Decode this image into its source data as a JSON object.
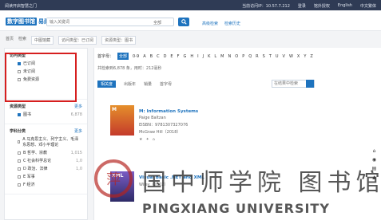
{
  "topbar": {
    "left": "阅读开启智慧之门",
    "right": [
      "当前访问IP：10.57.7.212",
      "登录",
      "馆外授权",
      "English",
      "中文繁体"
    ]
  },
  "logo": {
    "brand": "数字图书馆",
    "sub": "易阅通"
  },
  "search": {
    "placeholder": "输入关键词",
    "scope": "全部",
    "advanced": "高级检索",
    "history": "检索历史"
  },
  "breadcrumb": [
    "首页",
    "检索",
    "中图馆藏",
    "访问类型：已订阅",
    "资源类型：图书"
  ],
  "sidebar": {
    "access": {
      "title": "访问类型",
      "items": [
        {
          "label": "已订阅",
          "checked": true
        },
        {
          "label": "未订阅",
          "checked": false
        },
        {
          "label": "免费资源",
          "checked": false
        }
      ]
    },
    "resource": {
      "title": "资源类型",
      "more": "更多",
      "items": [
        {
          "label": "图书",
          "count": "6,878"
        }
      ]
    },
    "subject": {
      "title": "学科分类",
      "more": "更多",
      "items": [
        {
          "label": "A 马克思主义、列宁主义、毛泽东思想、邓小平理论",
          "count": ""
        },
        {
          "label": "B 哲学、宗教",
          "count": "1,015"
        },
        {
          "label": "C 社会科学总论",
          "count": "1,0"
        },
        {
          "label": "D 政治、法律",
          "count": "1,0"
        },
        {
          "label": "E 军事",
          "count": ""
        },
        {
          "label": "F 经济",
          "count": ""
        }
      ]
    }
  },
  "main": {
    "alpha_label": "首字母：",
    "alpha_active": "全部",
    "letters": [
      "0-9",
      "A",
      "B",
      "C",
      "D",
      "E",
      "F",
      "G",
      "H",
      "I",
      "J",
      "K",
      "L",
      "M",
      "N",
      "O",
      "P",
      "Q",
      "R",
      "S",
      "T",
      "U",
      "V",
      "W",
      "X",
      "Y",
      "Z"
    ],
    "found": "共检索到6,878 条，用时：212毫秒",
    "sort_active": "相关度",
    "sort_items": [
      "出版年",
      "销量",
      "首字母"
    ],
    "results_search_placeholder": "在结果中检索",
    "results": [
      {
        "title": "M: Information Systems",
        "author": "Paige Baltzan",
        "isbn": "EISBN：9781307327076",
        "publisher": "McGraw Hill（2018）",
        "cover_tag": "M"
      },
      {
        "title": "Visual Basic .NET and XML",
        "author": "",
        "isbn": "",
        "publisher": "Wiley（2002）",
        "cover_tag": "XML"
      }
    ]
  },
  "watermark": {
    "chinese": "国中师学院 图书馆",
    "english": "PINGXIANG UNIVERSITY"
  }
}
